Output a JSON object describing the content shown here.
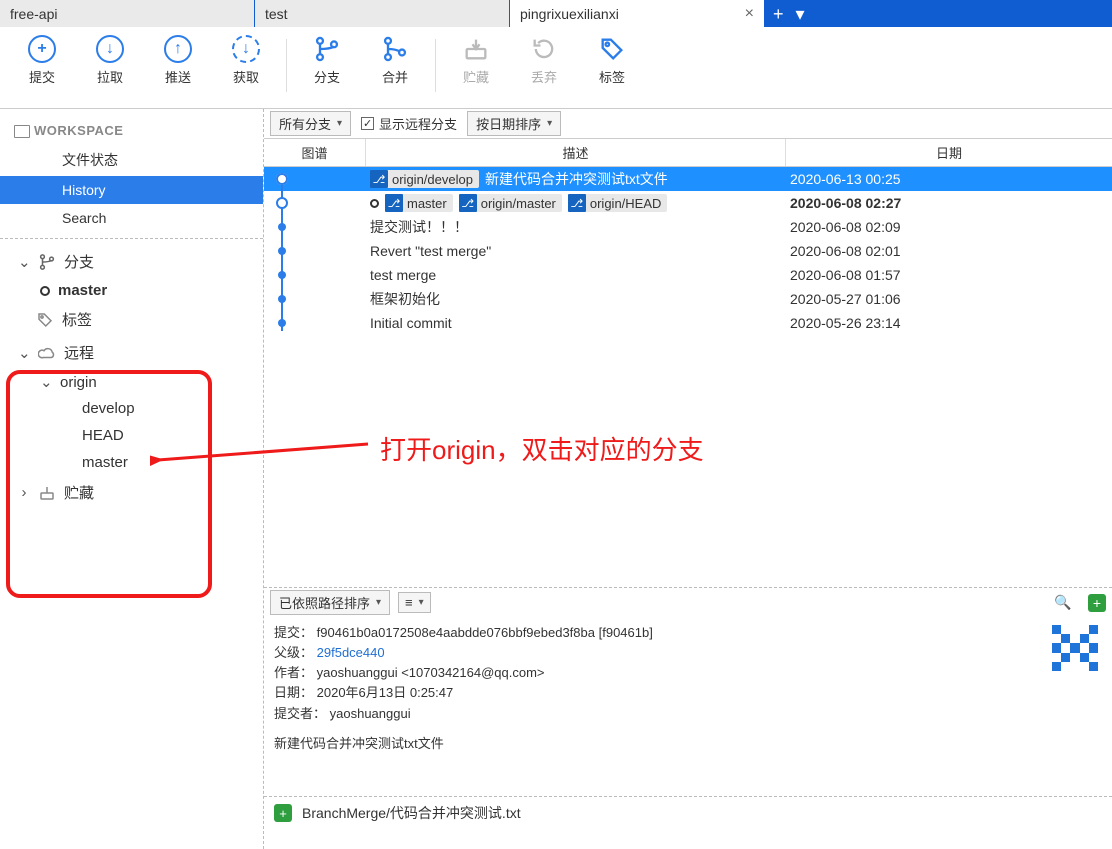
{
  "tabs": {
    "items": [
      {
        "label": "free-api",
        "active": false
      },
      {
        "label": "test",
        "active": false
      },
      {
        "label": "pingrixuexilianxi",
        "active": true
      }
    ],
    "add_label": "+",
    "menu_label": "▾"
  },
  "toolbar": {
    "commit": "提交",
    "pull": "拉取",
    "push": "推送",
    "fetch": "获取",
    "branch": "分支",
    "merge": "合并",
    "stash": "贮藏",
    "discard": "丢弃",
    "tag": "标签"
  },
  "sidebar": {
    "workspace": "WORKSPACE",
    "file_status": "文件状态",
    "history": "History",
    "search": "Search",
    "branches_label": "分支",
    "current_branch": "master",
    "tags_label": "标签",
    "remotes_label": "远程",
    "remote_name": "origin",
    "remote_branches": [
      "develop",
      "HEAD",
      "master"
    ],
    "stashes_label": "贮藏"
  },
  "filters": {
    "all_branches": "所有分支",
    "show_remote": "显示远程分支",
    "sort_by_date": "按日期排序"
  },
  "history": {
    "columns": {
      "graph": "图谱",
      "desc": "描述",
      "date": "日期"
    },
    "rows": [
      {
        "selected": true,
        "badges": [
          "origin/develop"
        ],
        "desc": "新建代码合并冲突测试txt文件",
        "date": "2020-06-13 00:25",
        "bold": false,
        "head_marker": false
      },
      {
        "selected": false,
        "head_marker": true,
        "badges": [
          "master",
          "origin/master",
          "origin/HEAD"
        ],
        "desc": "",
        "date": "2020-06-08 02:27",
        "bold": true
      },
      {
        "selected": false,
        "badges": [],
        "desc": "提交测试！！！",
        "date": "2020-06-08 02:09"
      },
      {
        "selected": false,
        "badges": [],
        "desc": "Revert \"test merge\"",
        "date": "2020-06-08 02:01"
      },
      {
        "selected": false,
        "badges": [],
        "desc": "test merge",
        "date": "2020-06-08 01:57"
      },
      {
        "selected": false,
        "badges": [],
        "desc": "框架初始化",
        "date": "2020-05-27 01:06"
      },
      {
        "selected": false,
        "badges": [],
        "desc": "Initial commit",
        "date": "2020-05-26 23:14"
      }
    ]
  },
  "lower": {
    "sort_path": "已依照路径排序"
  },
  "commit": {
    "labels": {
      "commit": "提交：",
      "parents": "父级：",
      "author": "作者：",
      "date": "日期：",
      "committer": "提交者："
    },
    "hash_full": "f90461b0a0172508e4aabdde076bbf9ebed3f8ba",
    "hash_short": "f90461b",
    "parent": "29f5dce440",
    "author": "yaoshuanggui <1070342164@qq.com>",
    "date": "2020年6月13日 0:25:47",
    "committer": "yaoshuanggui",
    "message": "新建代码合并冲突测试txt文件",
    "file": "BranchMerge/代码合并冲突测试.txt"
  },
  "annotation": {
    "text": "打开origin，双击对应的分支"
  },
  "colors": {
    "accent": "#2b7de9",
    "annotation": "#ef1a1a"
  }
}
